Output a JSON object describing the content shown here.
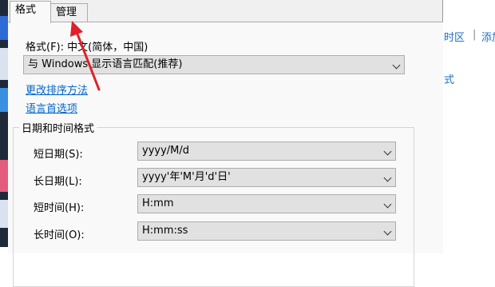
{
  "desktop": {
    "strip_colors": [
      "#1e2a3a",
      "#2f6bd6",
      "#d9e2ee",
      "#e45c7c",
      "#3a8fe0"
    ]
  },
  "background_window": {
    "links": [
      "时区",
      "添加",
      "式"
    ],
    "separator": "|"
  },
  "dialog": {
    "tabs": [
      {
        "label": "格式",
        "active": true
      },
      {
        "label": "管理",
        "active": false
      }
    ],
    "format": {
      "label": "格式(F): 中文(简体，中国)",
      "selected": "与 Windows 显示语言匹配(推荐)"
    },
    "links": {
      "change_sort": "更改排序方法",
      "language_prefs": "语言首选项"
    },
    "datetime_group": {
      "title": "日期和时间格式",
      "rows": [
        {
          "label": "短日期(S):",
          "value": "yyyy/M/d"
        },
        {
          "label": "长日期(L):",
          "value": "yyyy'年'M'月'd'日'"
        },
        {
          "label": "短时间(H):",
          "value": "H:mm"
        },
        {
          "label": "长时间(O):",
          "value": "H:mm:ss"
        }
      ]
    }
  },
  "annotation": {
    "type": "arrow",
    "color": "#e0202a",
    "points_to": "tab-manage"
  }
}
